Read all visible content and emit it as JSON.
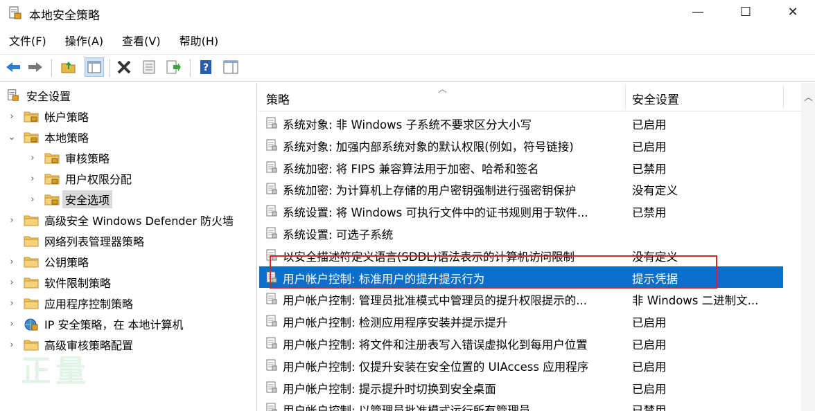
{
  "window": {
    "title": "本地安全策略",
    "minimize": "—",
    "maximize": "☐",
    "close": "✕"
  },
  "menu": [
    "文件(F)",
    "操作(A)",
    "查看(V)",
    "帮助(H)"
  ],
  "toolbar": [
    "back-icon",
    "forward-icon",
    "up-folder-icon",
    "show-tree-icon",
    "delete-icon",
    "properties-icon",
    "export-icon",
    "help-icon",
    "console-icon"
  ],
  "tree": {
    "root": "安全设置",
    "items": [
      {
        "label": "帐户策略",
        "indent": 1,
        "expander": "›",
        "selected": false
      },
      {
        "label": "本地策略",
        "indent": 1,
        "expander": "⌄",
        "selected": false
      },
      {
        "label": "审核策略",
        "indent": 2,
        "expander": "›",
        "selected": false
      },
      {
        "label": "用户权限分配",
        "indent": 2,
        "expander": "›",
        "selected": false
      },
      {
        "label": "安全选项",
        "indent": 2,
        "expander": "›",
        "selected": true
      },
      {
        "label": "高级安全 Windows Defender 防火墙",
        "indent": 1,
        "expander": "›",
        "selected": false
      },
      {
        "label": "网络列表管理器策略",
        "indent": 1,
        "expander": "",
        "selected": false
      },
      {
        "label": "公钥策略",
        "indent": 1,
        "expander": "›",
        "selected": false
      },
      {
        "label": "软件限制策略",
        "indent": 1,
        "expander": "›",
        "selected": false
      },
      {
        "label": "应用程序控制策略",
        "indent": 1,
        "expander": "›",
        "selected": false
      },
      {
        "label": "IP 安全策略，在 本地计算机",
        "indent": 1,
        "expander": "›",
        "selected": false
      },
      {
        "label": "高级审核策略配置",
        "indent": 1,
        "expander": "›",
        "selected": false
      }
    ]
  },
  "list": {
    "columns": {
      "policy": "策略",
      "setting": "安全设置"
    },
    "rows": [
      {
        "policy": "系统对象: 非 Windows 子系统不要求区分大小写",
        "setting": "已启用"
      },
      {
        "policy": "系统对象: 加强内部系统对象的默认权限(例如，符号链接)",
        "setting": "已启用"
      },
      {
        "policy": "系统加密: 将 FIPS 兼容算法用于加密、哈希和签名",
        "setting": "已禁用"
      },
      {
        "policy": "系统加密: 为计算机上存储的用户密钥强制进行强密钥保护",
        "setting": "没有定义"
      },
      {
        "policy": "系统设置: 将 Windows 可执行文件中的证书规则用于软件...",
        "setting": "已禁用"
      },
      {
        "policy": "系统设置: 可选子系统",
        "setting": ""
      },
      {
        "policy": "以安全描述符定义语言(SDDL)语法表示的计算机访问限制",
        "setting": "没有定义"
      },
      {
        "policy": "用户帐户控制: 标准用户的提升提示行为",
        "setting": "提示凭据",
        "selected": true
      },
      {
        "policy": "用户帐户控制: 管理员批准模式中管理员的提升权限提示的...",
        "setting": "非 Windows 二进制文..."
      },
      {
        "policy": "用户帐户控制: 检测应用程序安装并提示提升",
        "setting": "已启用"
      },
      {
        "policy": "用户帐户控制: 将文件和注册表写入错误虚拟化到每用户位置",
        "setting": "已启用"
      },
      {
        "policy": "用户帐户控制: 仅提升安装在安全位置的 UIAccess 应用程序",
        "setting": "已启用"
      },
      {
        "policy": "用户帐户控制: 提示提升时切换到安全桌面",
        "setting": "已启用"
      },
      {
        "policy": "用户帐户控制: 以管理员批准模式运行所有管理员",
        "setting": "已禁用"
      }
    ]
  },
  "colors": {
    "selection": "#0a6fc8",
    "highlight_box": "#d8232a",
    "tree_selection": "#d9d9d9"
  },
  "watermark": "正量"
}
